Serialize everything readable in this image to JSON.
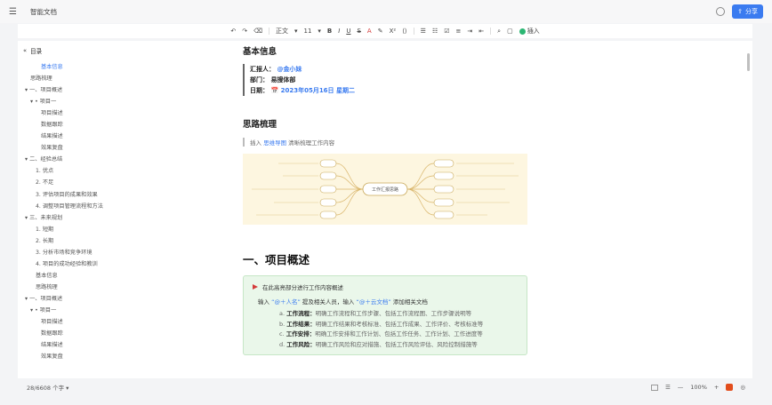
{
  "titlebar": {
    "menu_icon": "☰",
    "title": "智能文档",
    "share_label": "分享"
  },
  "toolbar": {
    "undo": "↶",
    "redo": "↷",
    "format_painter": "⌫",
    "style": "正文",
    "size": "11",
    "bold": "B",
    "italic": "I",
    "underline": "U",
    "strike": "S",
    "font_color": "A",
    "highlight": "✎",
    "superscript": "X²",
    "code": "⟨⟩",
    "ul": "☰",
    "ol": "☷",
    "task": "☑",
    "align": "≡",
    "indent": "⇥",
    "outdent": "⇤",
    "search": "⌕",
    "comment": "▢",
    "insert_label": "插入"
  },
  "outline": {
    "header": "目录",
    "items": [
      {
        "text": "基本信息",
        "level": "lvl3",
        "active": true
      },
      {
        "text": "思路梳理",
        "level": "lvl2"
      },
      {
        "text": "▾ 一、项目概述",
        "level": "lvl1"
      },
      {
        "text": "▾ • 项目一",
        "level": "lvl2"
      },
      {
        "text": "项目描述",
        "level": "lvl3"
      },
      {
        "text": "数据跟踪",
        "level": "lvl3"
      },
      {
        "text": "结果描述",
        "level": "lvl3"
      },
      {
        "text": "效果复盘",
        "level": "lvl3"
      },
      {
        "text": "▾ 二、经验总结",
        "level": "lvl1"
      },
      {
        "text": "1. 优点",
        "level": "lvl1b"
      },
      {
        "text": "2. 不足",
        "level": "lvl1b"
      },
      {
        "text": "3. 评估项目的成果和效果",
        "level": "lvl1b"
      },
      {
        "text": "4. 调整项目管理流程和方法",
        "level": "lvl1b"
      },
      {
        "text": "▾ 三、未来规划",
        "level": "lvl1"
      },
      {
        "text": "1. 短期",
        "level": "lvl1b"
      },
      {
        "text": "2. 长期",
        "level": "lvl1b"
      },
      {
        "text": "3. 分析市场和竞争环境",
        "level": "lvl1b"
      },
      {
        "text": "4. 项目的成功经验和教训",
        "level": "lvl1b"
      },
      {
        "text": "基本信息",
        "level": "lvl1b"
      },
      {
        "text": "思路梳理",
        "level": "lvl1b"
      },
      {
        "text": "▾ 一、项目概述",
        "level": "lvl1"
      },
      {
        "text": "▾ • 项目一",
        "level": "lvl2"
      },
      {
        "text": "项目描述",
        "level": "lvl3"
      },
      {
        "text": "数据跟踪",
        "level": "lvl3"
      },
      {
        "text": "结果描述",
        "level": "lvl3"
      },
      {
        "text": "效果复盘",
        "level": "lvl3"
      }
    ]
  },
  "doc": {
    "basic_title": "基本信息",
    "reporter_label": "汇报人：",
    "reporter_value": "@金小妹",
    "dept_label": "部门：",
    "dept_value": "易搜体部",
    "date_label": "日期：",
    "date_value": "📅 2023年05月16日 星期二",
    "idea_title": "思路梳理",
    "idea_prefix": "插入",
    "idea_link": "思维导图",
    "idea_suffix": "清晰梳理工作内容",
    "mindmap_center": "工作汇报思路",
    "project_title": "一、项目概述",
    "callout_head": "在此高亮部分进行工作内容概述",
    "callout_sub_1": "输入",
    "callout_sub_2": "“@＋人名”",
    "callout_sub_3": "提及相关人员，输入",
    "callout_sub_4": "“@＋云文档”",
    "callout_sub_5": "添加相关文档",
    "list": [
      {
        "num": "a.",
        "bold": "工作流程：",
        "text": "明确工作流程和工作步骤、包括工作流程图、工作步骤说明等"
      },
      {
        "num": "b.",
        "bold": "工作结果：",
        "text": "明确工作结果和考核标准、包括工作成果、工作评价、考核标准等"
      },
      {
        "num": "c.",
        "bold": "工作安排：",
        "text": "明确工作安排和工作计划、包括工作任务、工作计划、工作进度等"
      },
      {
        "num": "d.",
        "bold": "工作风险：",
        "text": "明确工作风险和应对措施、包括工作风险评估、风险控制措施等"
      }
    ]
  },
  "status": {
    "wordcount": "28/6608 个字 ▾",
    "zoom": "100%",
    "minus": "—",
    "plus": "+"
  }
}
